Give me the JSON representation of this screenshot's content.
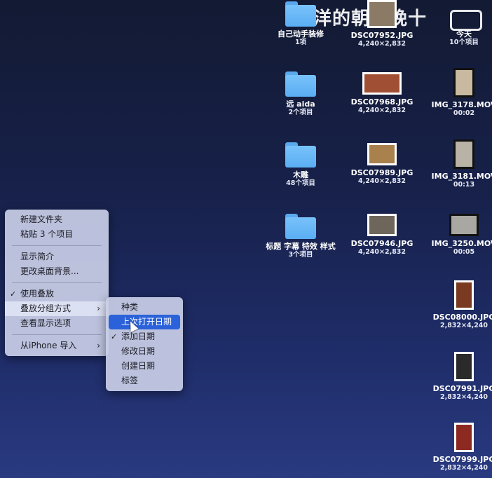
{
  "watermark": {
    "text": "大洋的朝九晚十"
  },
  "desktop": {
    "col1": [
      {
        "name": "自己动手装修",
        "sub": "1项",
        "kind": "folder"
      },
      {
        "name": "远 aida",
        "sub": "2个项目",
        "kind": "folder"
      },
      {
        "name": "木雕",
        "sub": "48个项目",
        "kind": "folder"
      },
      {
        "name": "标题 字幕 特效 样式",
        "sub": "3个项目",
        "kind": "folder"
      }
    ],
    "col2": [
      {
        "name": "DSC07952.JPG",
        "sub": "4,240×2,832",
        "kind": "photo",
        "color": "#8a7a66"
      },
      {
        "name": "DSC07968.JPG",
        "sub": "4,240×2,832",
        "kind": "photo",
        "color": "#a04f34"
      },
      {
        "name": "DSC07989.JPG",
        "sub": "4,240×2,832",
        "kind": "photo",
        "color": "#a8814c"
      },
      {
        "name": "DSC07946.JPG",
        "sub": "4,240×2,832",
        "kind": "photo",
        "color": "#6e665a"
      }
    ],
    "col3": [
      {
        "name": "今天",
        "sub": "10个项目",
        "kind": "stack"
      },
      {
        "name": "IMG_3178.MOV",
        "sub": "00:02",
        "kind": "video",
        "color": "#c9b9a0"
      },
      {
        "name": "IMG_3181.MOV",
        "sub": "00:13",
        "kind": "video",
        "color": "#b9b2a6"
      },
      {
        "name": "IMG_3250.MOV",
        "sub": "00:05",
        "kind": "video",
        "color": "#a9a7a2"
      },
      {
        "name": "DSC08000.JPG",
        "sub": "2,832×4,240",
        "kind": "photo",
        "color": "#7a3a22"
      },
      {
        "name": "DSC07991.JPG",
        "sub": "2,832×4,240",
        "kind": "photo",
        "color": "#2a2a2a"
      },
      {
        "name": "DSC07999.JPG",
        "sub": "2,832×4,240",
        "kind": "photo",
        "color": "#8c2a22"
      }
    ]
  },
  "context_menu": {
    "items": [
      "新建文件夹",
      "粘贴 3 个项目",
      "显示简介",
      "更改桌面背景...",
      "使用叠放",
      "叠放分组方式",
      "查看显示选项",
      "从iPhone 导入"
    ],
    "check": "✓",
    "arrow": "›"
  },
  "submenu": {
    "items": [
      "种类",
      "上次打开日期",
      "添加日期",
      "修改日期",
      "创建日期",
      "标签"
    ],
    "check": "✓"
  }
}
